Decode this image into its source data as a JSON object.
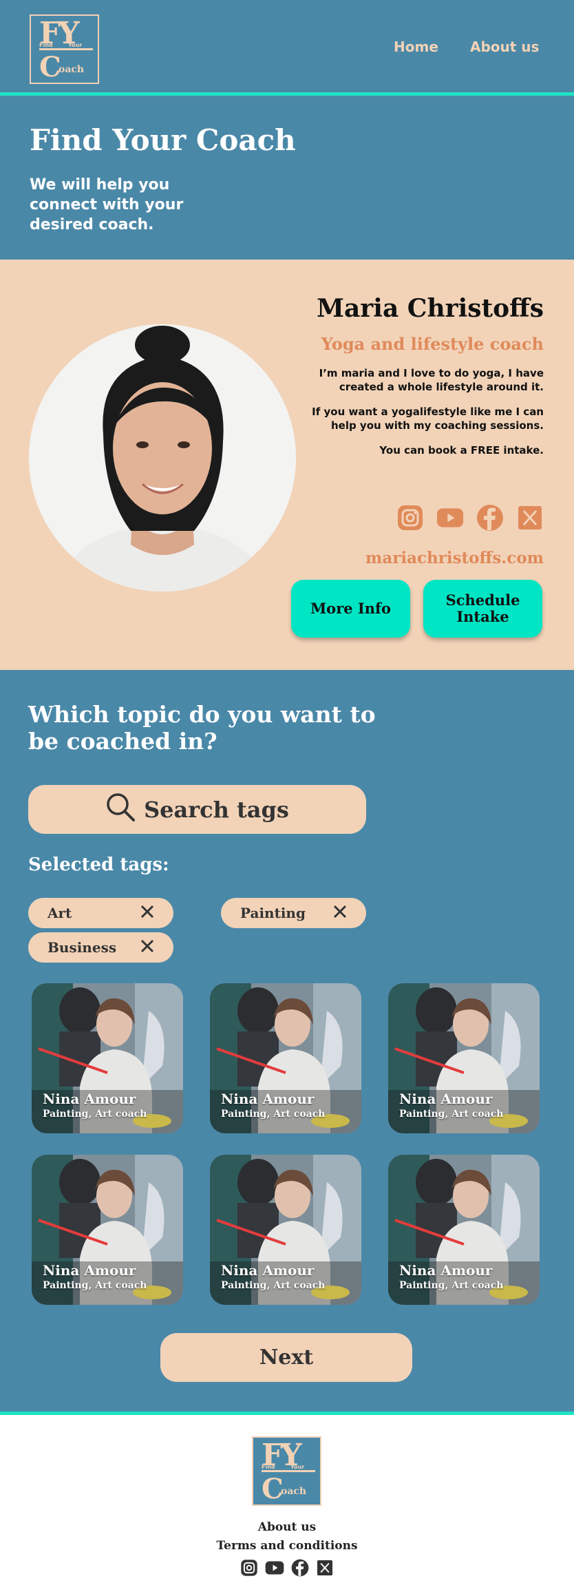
{
  "header": {
    "logo": {
      "letters": "FY",
      "find": "Find",
      "your": "Your",
      "c": "C",
      "oach": "oach"
    },
    "nav": [
      {
        "label": "Home"
      },
      {
        "label": "About us"
      }
    ]
  },
  "hero": {
    "title": "Find Your Coach",
    "subtitle": "We will help you connect with your desired coach."
  },
  "featured": {
    "name": "Maria Christoffs",
    "role": "Yoga and lifestyle coach",
    "bio": [
      "I’m maria and I love to do yoga, I have created a whole lifestyle around it.",
      "If you want a yogalifestyle like me I can help you with my coaching sessions.",
      "You can book a FREE intake."
    ],
    "socials": [
      "instagram-icon",
      "youtube-icon",
      "facebook-icon",
      "x-icon"
    ],
    "website": "mariachristoffs.com",
    "buttons": {
      "more_info": "More Info",
      "schedule": "Schedule Intake"
    },
    "accent": "#e08a5a"
  },
  "topics": {
    "title": "Which topic do you want to be coached in?",
    "search_label": "Search tags",
    "selected_title": "Selected tags:",
    "tags": [
      {
        "label": "Art"
      },
      {
        "label": "Painting"
      },
      {
        "label": "Business"
      }
    ],
    "coaches": [
      {
        "name": "Nina Amour",
        "tags": "Painting, Art coach"
      },
      {
        "name": "Nina Amour",
        "tags": "Painting, Art coach"
      },
      {
        "name": "Nina Amour",
        "tags": "Painting, Art coach"
      },
      {
        "name": "Nina Amour",
        "tags": "Painting, Art coach"
      },
      {
        "name": "Nina Amour",
        "tags": "Painting, Art coach"
      },
      {
        "name": "Nina Amour",
        "tags": "Painting, Art coach"
      }
    ],
    "next_label": "Next"
  },
  "footer": {
    "links": [
      {
        "label": "About us"
      },
      {
        "label": "Terms and conditions"
      }
    ]
  },
  "colors": {
    "blue": "#4a88a8",
    "peach": "#f2d3b8",
    "aqua": "#00e5c4",
    "teal_border": "#1ee3c4"
  }
}
